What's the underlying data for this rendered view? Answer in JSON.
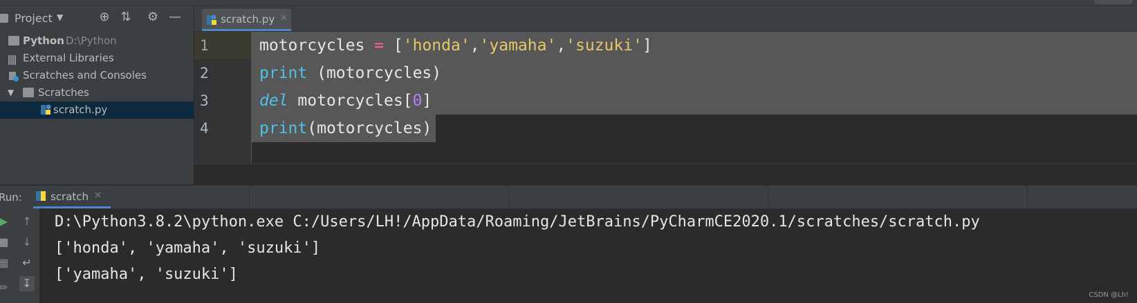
{
  "project_panel": {
    "title": "Project",
    "tree": [
      {
        "label": "Python",
        "hint": "D:\\Python"
      },
      {
        "label": "External Libraries"
      },
      {
        "label": "Scratches and Consoles"
      },
      {
        "label": "Scratches"
      },
      {
        "label": "scratch.py"
      }
    ]
  },
  "editor": {
    "tab_label": "scratch.py",
    "line_numbers": [
      "1",
      "2",
      "3",
      "4"
    ],
    "code": [
      [
        {
          "t": "motorcycles ",
          "c": "id"
        },
        {
          "t": "=",
          "c": "op"
        },
        {
          "t": " [",
          "c": "id"
        },
        {
          "t": "'honda'",
          "c": "str"
        },
        {
          "t": ",",
          "c": "id"
        },
        {
          "t": "'yamaha'",
          "c": "str"
        },
        {
          "t": ",",
          "c": "id"
        },
        {
          "t": "'suzuki'",
          "c": "str"
        },
        {
          "t": "]",
          "c": "id"
        }
      ],
      [
        {
          "t": "print",
          "c": "kw"
        },
        {
          "t": " (motorcycles)",
          "c": "id"
        }
      ],
      [
        {
          "t": "del",
          "c": "kwi"
        },
        {
          "t": " motorcycles[",
          "c": "id"
        },
        {
          "t": "0",
          "c": "num"
        },
        {
          "t": "]",
          "c": "id"
        }
      ],
      [
        {
          "t": "print",
          "c": "kw"
        },
        {
          "t": "(motorcycles)",
          "c": "id"
        }
      ]
    ]
  },
  "run_panel": {
    "label": "Run:",
    "tab_label": "scratch",
    "output": [
      "D:\\Python3.8.2\\python.exe C:/Users/LH!/AppData/Roaming/JetBrains/PyCharmCE2020.1/scratches/scratch.py",
      "['honda', 'yamaha', 'suzuki']",
      "['yamaha', 'suzuki']"
    ]
  },
  "watermark": "CSDN @Lh!",
  "colors": {
    "accent": "#4a88c7",
    "selection": "#575757",
    "keyword": "#4fc1e9",
    "string": "#e6c76a",
    "operator": "#ff6188",
    "number": "#ae81ff"
  },
  "icons": {
    "header": [
      "folder-icon",
      "chevron-down-icon",
      "target-icon",
      "collapse-icon",
      "gear-icon",
      "minimize-icon"
    ],
    "run_toolbar": [
      "run-icon",
      "arrow-up-icon",
      "stop-icon",
      "arrow-down-icon",
      "wrap-icon",
      "layout-icon",
      "scroll-to-end-icon",
      "pin-icon"
    ]
  }
}
